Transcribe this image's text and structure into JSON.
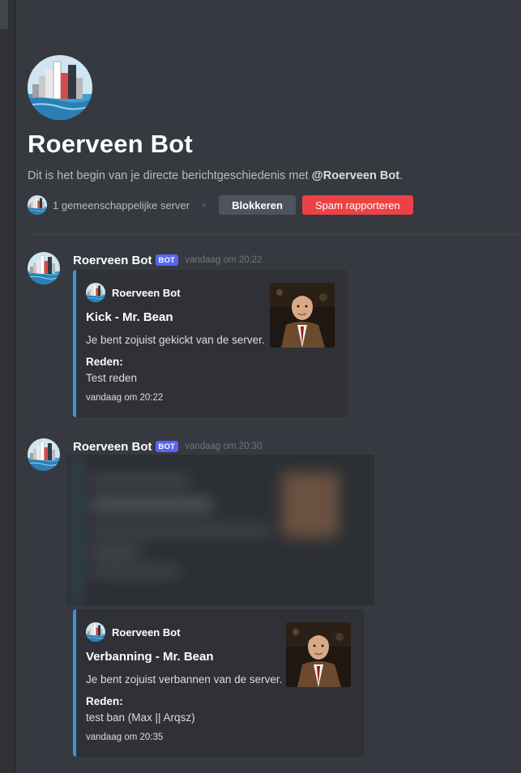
{
  "header": {
    "title": "Roerveen Bot",
    "intro_text": "Dit is het begin van je directe berichtgeschiedenis met ",
    "intro_handle": "@Roerveen Bot",
    "intro_end": ".",
    "mutual_servers": "1 gemeenschappelijke server",
    "block_label": "Blokkeren",
    "spam_label": "Spam rapporteren"
  },
  "messages": [
    {
      "username": "Roerveen Bot",
      "tag": "BOT",
      "time": "vandaag om 20:22",
      "embed": {
        "author": "Roerveen Bot",
        "title": "Kick - Mr. Bean",
        "description": "Je bent zojuist gekickt van de server.",
        "field_name": "Reden:",
        "field_value": "Test reden",
        "footer": "vandaag om 20:22"
      }
    },
    {
      "username": "Roerveen Bot",
      "tag": "BOT",
      "time": "vandaag om 20:30",
      "embed": {
        "author": "Roerveen Bot",
        "title": "Verbanning - Mr. Bean",
        "description": "Je bent zojuist verbannen van de server.",
        "field_name": "Reden:",
        "field_value": "test ban (Max || Arqsz)",
        "footer": "vandaag om 20:35"
      }
    }
  ],
  "colors": {
    "background": "#36393f",
    "embed_bg": "#2f3136",
    "embed_accent": "#3498db",
    "bot_tag": "#5865f2",
    "spam_button": "#ed4245",
    "block_button": "#4f545c"
  },
  "icons": {
    "bot_avatar": "city-skyline-avatar-icon",
    "thumbnail": "person-photo-thumbnail"
  }
}
